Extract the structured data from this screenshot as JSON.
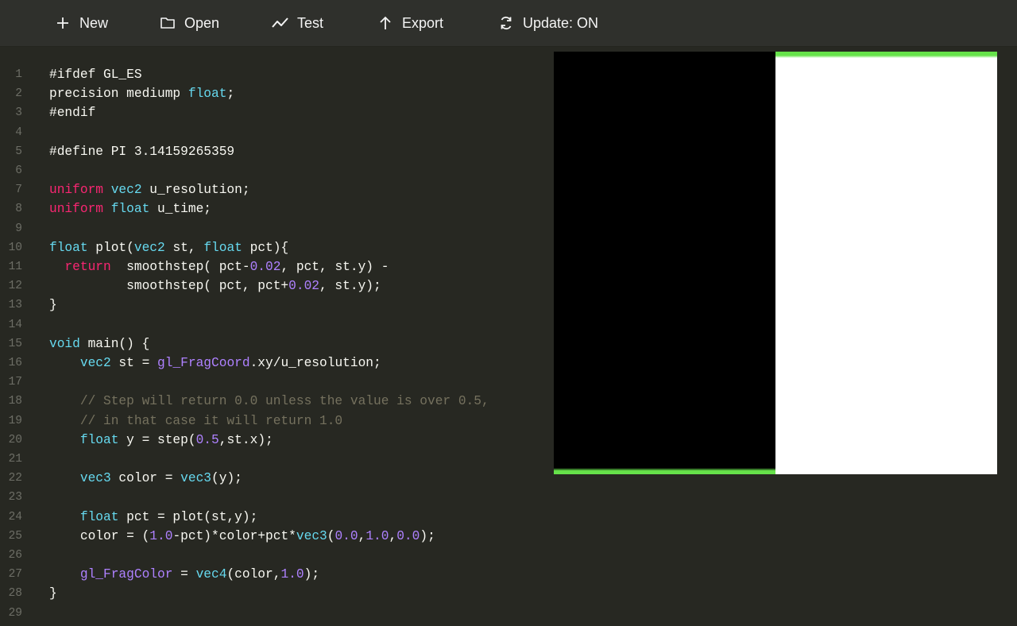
{
  "toolbar": {
    "buttons": [
      {
        "label": "New",
        "icon": "plus-icon"
      },
      {
        "label": "Open",
        "icon": "folder-icon"
      },
      {
        "label": "Test",
        "icon": "line-chart-icon"
      },
      {
        "label": "Export",
        "icon": "arrow-up-icon"
      },
      {
        "label": "Update: ON",
        "icon": "refresh-icon"
      }
    ]
  },
  "editor": {
    "lines": [
      [
        [
          "#ifdef GL_ES",
          "txt"
        ]
      ],
      [
        [
          "precision mediump ",
          "txt"
        ],
        [
          "float",
          "type"
        ],
        [
          ";",
          "txt"
        ]
      ],
      [
        [
          "#endif",
          "txt"
        ]
      ],
      [],
      [
        [
          "#define PI 3.14159265359",
          "txt"
        ]
      ],
      [],
      [
        [
          "uniform",
          "kw"
        ],
        [
          " ",
          "txt"
        ],
        [
          "vec2",
          "type"
        ],
        [
          " u_resolution;",
          "txt"
        ]
      ],
      [
        [
          "uniform",
          "kw"
        ],
        [
          " ",
          "txt"
        ],
        [
          "float",
          "type"
        ],
        [
          " u_time;",
          "txt"
        ]
      ],
      [],
      [
        [
          "float",
          "type"
        ],
        [
          " plot(",
          "txt"
        ],
        [
          "vec2",
          "type"
        ],
        [
          " st, ",
          "txt"
        ],
        [
          "float",
          "type"
        ],
        [
          " pct){",
          "txt"
        ]
      ],
      [
        [
          "  ",
          "txt"
        ],
        [
          "return",
          "kw"
        ],
        [
          "  smoothstep( pct-",
          "txt"
        ],
        [
          "0.02",
          "num"
        ],
        [
          ", pct, st.y) -",
          "txt"
        ]
      ],
      [
        [
          "          smoothstep( pct, pct+",
          "txt"
        ],
        [
          "0.02",
          "num"
        ],
        [
          ", st.y);",
          "txt"
        ]
      ],
      [
        [
          "}",
          "txt"
        ]
      ],
      [],
      [
        [
          "void",
          "type"
        ],
        [
          " main() {",
          "txt"
        ]
      ],
      [
        [
          "    ",
          "txt"
        ],
        [
          "vec2",
          "type"
        ],
        [
          " st = ",
          "txt"
        ],
        [
          "gl_FragCoord",
          "bi"
        ],
        [
          ".xy/u_resolution;",
          "txt"
        ]
      ],
      [],
      [
        [
          "    // Step will return 0.0 unless the value is over 0.5,",
          "com"
        ]
      ],
      [
        [
          "    // in that case it will return 1.0",
          "com"
        ]
      ],
      [
        [
          "    ",
          "txt"
        ],
        [
          "float",
          "type"
        ],
        [
          " y = step(",
          "txt"
        ],
        [
          "0.5",
          "num"
        ],
        [
          ",st.x);",
          "txt"
        ]
      ],
      [],
      [
        [
          "    ",
          "txt"
        ],
        [
          "vec3",
          "type"
        ],
        [
          " color = ",
          "txt"
        ],
        [
          "vec3",
          "type"
        ],
        [
          "(y);",
          "txt"
        ]
      ],
      [],
      [
        [
          "    ",
          "txt"
        ],
        [
          "float",
          "type"
        ],
        [
          " pct = plot(st,y);",
          "txt"
        ]
      ],
      [
        [
          "    color = (",
          "txt"
        ],
        [
          "1.0",
          "num"
        ],
        [
          "-pct)*color+pct*",
          "txt"
        ],
        [
          "vec3",
          "type"
        ],
        [
          "(",
          "txt"
        ],
        [
          "0.0",
          "num"
        ],
        [
          ",",
          "txt"
        ],
        [
          "1.0",
          "num"
        ],
        [
          ",",
          "txt"
        ],
        [
          "0.0",
          "num"
        ],
        [
          ");",
          "txt"
        ]
      ],
      [],
      [
        [
          "    ",
          "txt"
        ],
        [
          "gl_FragColor",
          "bi"
        ],
        [
          " = ",
          "txt"
        ],
        [
          "vec4",
          "type"
        ],
        [
          "(color,",
          "txt"
        ],
        [
          "1.0",
          "num"
        ],
        [
          ");",
          "txt"
        ]
      ],
      [
        [
          "}",
          "txt"
        ]
      ],
      []
    ]
  },
  "preview": {
    "step_threshold": 0.5,
    "plot_color": "#66e24a",
    "left_color": "#000000",
    "right_color": "#ffffff"
  },
  "colors": {
    "background": "#272822",
    "toolbar": "#2f302c",
    "keyword": "#f92672",
    "type": "#66d9ef",
    "number": "#ae81ff",
    "comment": "#75715e"
  }
}
